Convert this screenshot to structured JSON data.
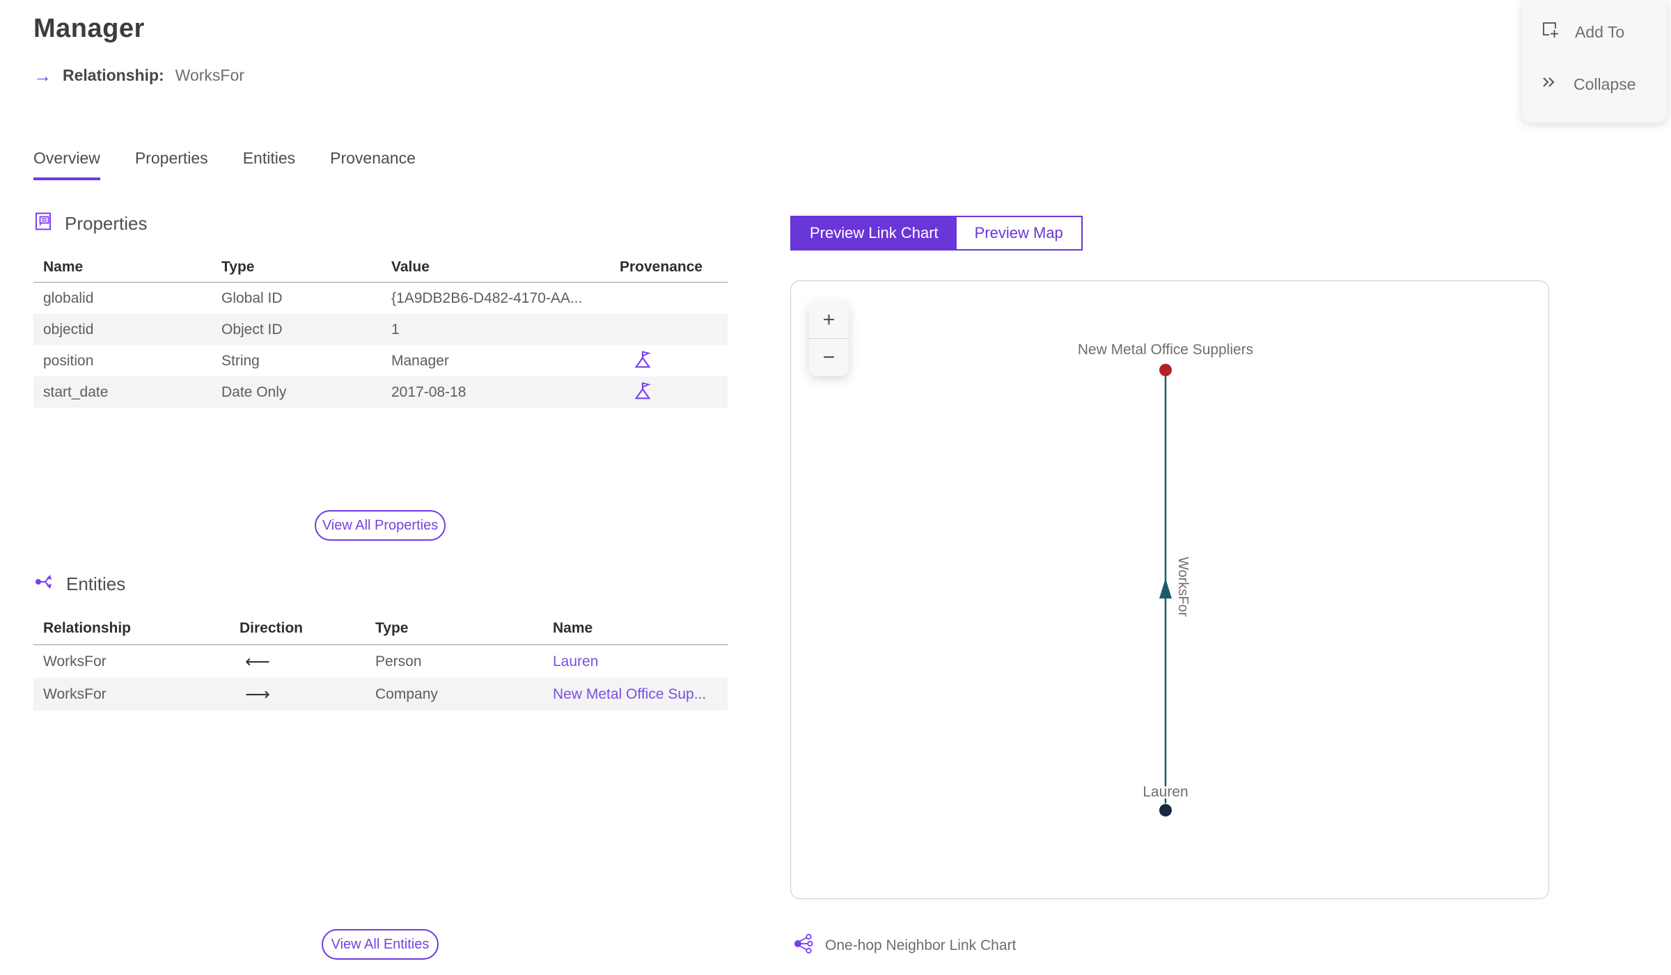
{
  "header": {
    "title": "Manager",
    "relationship_arrow": "→",
    "relationship_label": "Relationship:",
    "relationship_value": "WorksFor"
  },
  "actions": {
    "add_to_label": "Add To",
    "collapse_label": "Collapse"
  },
  "tabs": [
    {
      "label": "Overview",
      "active": true
    },
    {
      "label": "Properties",
      "active": false
    },
    {
      "label": "Entities",
      "active": false
    },
    {
      "label": "Provenance",
      "active": false
    }
  ],
  "properties_section": {
    "heading": "Properties",
    "columns": {
      "name": "Name",
      "type": "Type",
      "value": "Value",
      "provenance": "Provenance"
    },
    "rows": [
      {
        "name": "globalid",
        "type": "Global ID",
        "value": "{1A9DB2B6-D482-4170-AA...",
        "has_provenance": false
      },
      {
        "name": "objectid",
        "type": "Object ID",
        "value": "1",
        "has_provenance": false
      },
      {
        "name": "position",
        "type": "String",
        "value": "Manager",
        "has_provenance": true
      },
      {
        "name": "start_date",
        "type": "Date Only",
        "value": "2017-08-18",
        "has_provenance": true
      }
    ],
    "view_all_label": "View All Properties"
  },
  "entities_section": {
    "heading": "Entities",
    "columns": {
      "relationship": "Relationship",
      "direction": "Direction",
      "type": "Type",
      "name": "Name"
    },
    "rows": [
      {
        "relationship": "WorksFor",
        "direction": "⟵",
        "type": "Person",
        "name": "Lauren"
      },
      {
        "relationship": "WorksFor",
        "direction": "⟶",
        "type": "Company",
        "name": "New Metal Office Sup..."
      }
    ],
    "view_all_label": "View All Entities"
  },
  "preview": {
    "toggle": [
      {
        "label": "Preview Link Chart",
        "active": true
      },
      {
        "label": "Preview Map",
        "active": false
      }
    ],
    "zoom_in": "+",
    "zoom_out": "−",
    "graph": {
      "nodes": [
        {
          "label": "New Metal Office Suppliers",
          "color": "#b32025"
        },
        {
          "label": "Lauren",
          "color": "#1a2740"
        }
      ],
      "edge": {
        "label": "WorksFor",
        "from": "Lauren",
        "to": "New Metal Office Suppliers",
        "color": "#1c5a68"
      }
    },
    "caption": "One-hop Neighbor Link Chart"
  },
  "colors": {
    "accent_purple": "#6a35d9",
    "link_purple": "#7b4fe0",
    "icon_purple": "#7a3ff2",
    "node_top_red": "#b32025",
    "node_bottom_navy": "#1a2740",
    "edge_teal": "#1c5a68",
    "row_alt_gray": "#f4f4f4"
  }
}
